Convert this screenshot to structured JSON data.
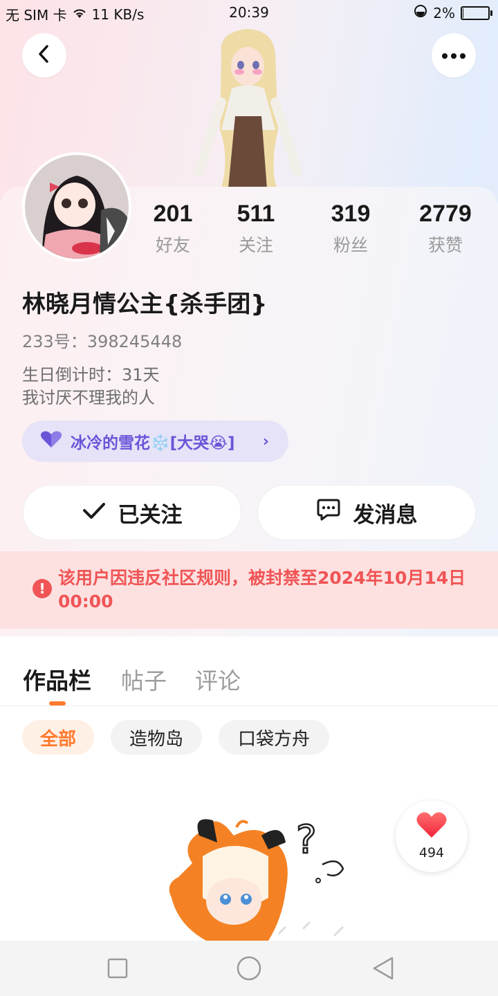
{
  "status_bar": {
    "carrier": "无 SIM 卡",
    "speed": "11 KB/s",
    "time": "20:39",
    "battery": "2%",
    "battery_fraction": 0.02
  },
  "header": {
    "back_icon": "chevron-left-icon",
    "more_icon": "more-dots-icon"
  },
  "stats": [
    {
      "num": "201",
      "label": "好友"
    },
    {
      "num": "511",
      "label": "关注"
    },
    {
      "num": "319",
      "label": "粉丝"
    },
    {
      "num": "2779",
      "label": "获赞"
    }
  ],
  "profile": {
    "name": "林晓月情公主{杀手团}",
    "uid": "233号：398245448",
    "bio_line1": "生日倒计时：31天",
    "bio_line2": "我讨厌不理我的人"
  },
  "club": {
    "label": "冰冷的雪花❄️[大哭😭]",
    "icon": "purple-heart-icon",
    "chevron": "›"
  },
  "actions": {
    "follow_label": "已关注",
    "message_label": "发消息"
  },
  "ban_notice": {
    "text": "该用户因违反社区规则，被封禁至2024年10月14日 00:00",
    "icon": "exclamation-icon"
  },
  "tabs": [
    {
      "label": "作品栏",
      "active": true
    },
    {
      "label": "帖子",
      "active": false
    },
    {
      "label": "评论",
      "active": false
    }
  ],
  "chips": [
    {
      "label": "全部",
      "active": true
    },
    {
      "label": "造物岛",
      "active": false
    },
    {
      "label": "口袋方舟",
      "active": false
    }
  ],
  "like_widget": {
    "count": "494",
    "icon": "heart-icon"
  },
  "colors": {
    "accent": "#ff7a2f",
    "ban_red": "#f05455",
    "club_purple": "#6a55d8"
  }
}
